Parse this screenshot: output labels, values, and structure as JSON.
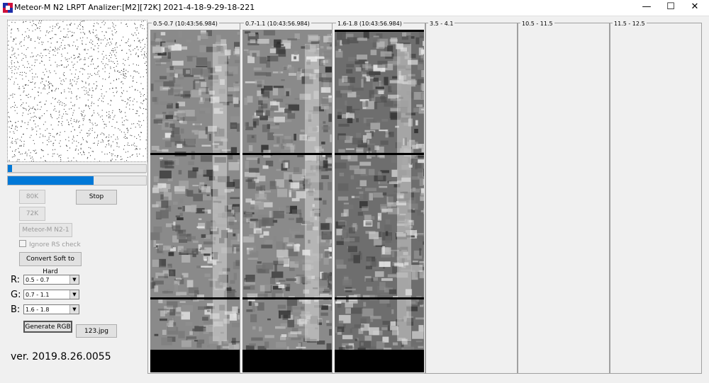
{
  "window": {
    "title": "Meteor-M N2 LRPT Analizer:[M2][72K] 2021-4-18-9-29-18-221",
    "minimize_icon": "minimize-icon",
    "maximize_icon": "maximize-icon",
    "close_icon": "close-icon"
  },
  "progress": {
    "first_fraction": 0.03,
    "second_fraction": 0.62
  },
  "buttons": {
    "rate_80k": "80K",
    "stop": "Stop",
    "rate_72k": "72K",
    "satellite": "Meteor-M N2-1",
    "convert": "Convert Soft to Hard",
    "generate_rgb": "Generate RGB",
    "output_file": "123.jpg"
  },
  "ignore_rs": {
    "label": "Ignore RS check",
    "checked": false
  },
  "rgb": {
    "r_label": "R:",
    "g_label": "G:",
    "b_label": "B:",
    "r_value": "0.5 - 0.7",
    "g_value": "0.7 - 1.1",
    "b_value": "1.6 - 1.8"
  },
  "version": "ver. 2019.8.26.0055",
  "channels": [
    {
      "label": "0.5-0.7 (10:43:56.984)",
      "has_image": true
    },
    {
      "label": "0.7-1.1 (10:43:56.984)",
      "has_image": true
    },
    {
      "label": "1.6-1.8 (10:43:56.984)",
      "has_image": true
    },
    {
      "label": "3.5 - 4.1",
      "has_image": false
    },
    {
      "label": "10.5 - 11.5",
      "has_image": false
    },
    {
      "label": "11.5 - 12.5",
      "has_image": false
    }
  ]
}
